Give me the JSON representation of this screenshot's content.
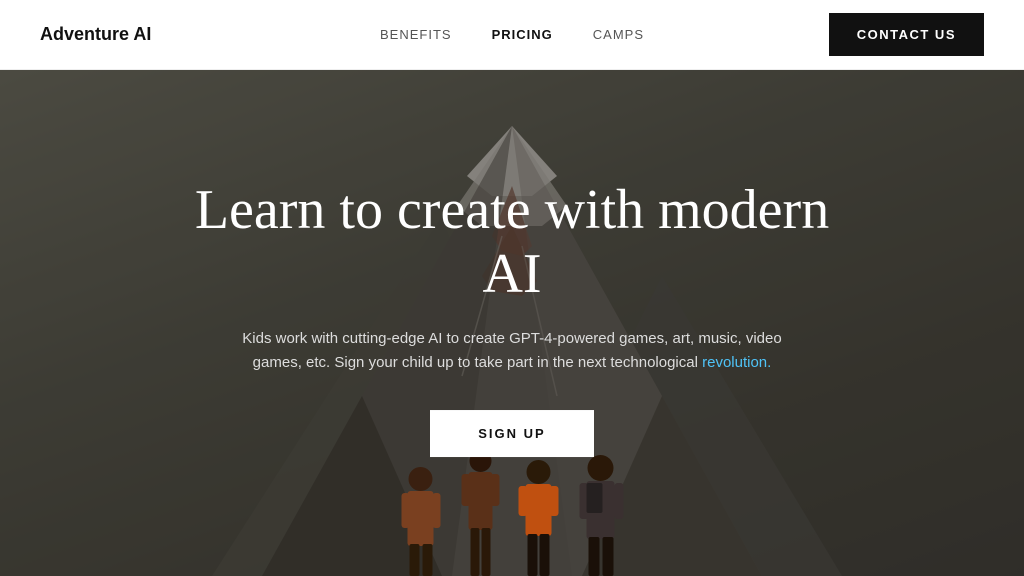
{
  "navbar": {
    "logo": "Adventure AI",
    "links": [
      {
        "label": "BENEFITS",
        "active": false
      },
      {
        "label": "PRICING",
        "active": true
      },
      {
        "label": "CAMPS",
        "active": false
      }
    ],
    "contact_button": "CONTACT US"
  },
  "hero": {
    "title": "Learn to create with modern AI",
    "subtitle_part1": "Kids work with cutting-edge AI to create GPT-4-powered games, art, music, video games, etc. Sign your child up to take part in the next technological",
    "subtitle_highlight": "revolution.",
    "signup_button": "SIGN UP",
    "figures_count": 4
  }
}
